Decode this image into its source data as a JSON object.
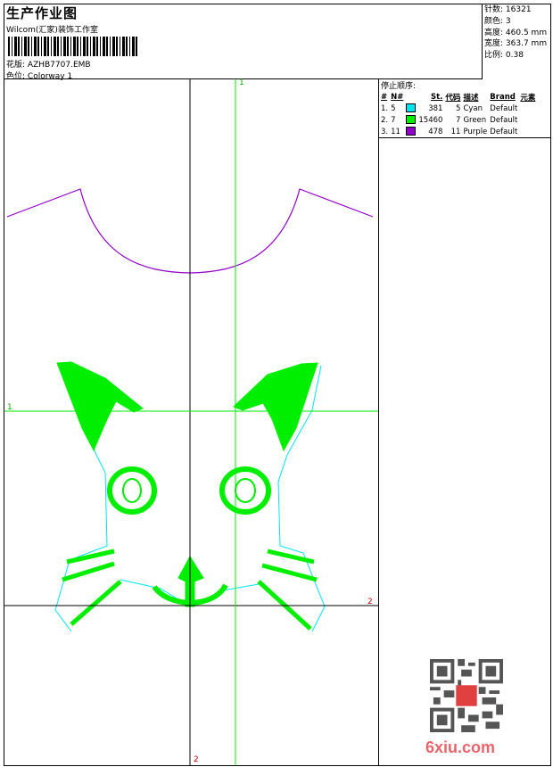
{
  "header": {
    "title": "生产作业图",
    "studio": "Wilcom(汇家)装饰工作室",
    "design_label": "花版:",
    "design_file": "AZHB7707.EMB",
    "colorway_label": "色位:",
    "colorway": "Colorway 1"
  },
  "stats": [
    {
      "label": "针数:",
      "value": "16321"
    },
    {
      "label": "颜色:",
      "value": "3"
    },
    {
      "label": "高度:",
      "value": "460.5 mm"
    },
    {
      "label": "宽度:",
      "value": "363.7 mm"
    },
    {
      "label": "比例:",
      "value": "0.38"
    }
  ],
  "stop_sequence": {
    "title": "停止顺序:",
    "columns": [
      "#",
      "N#",
      "",
      "St.",
      "代码",
      "描述",
      "Brand",
      "元素"
    ],
    "rows": [
      {
        "idx": "1.",
        "n": "5",
        "color": "#00e5f0",
        "st": "381",
        "code": "5",
        "desc": "Cyan",
        "brand": "Default"
      },
      {
        "idx": "2.",
        "n": "7",
        "color": "#00ee00",
        "st": "15460",
        "code": "7",
        "desc": "Green",
        "brand": "Default"
      },
      {
        "idx": "3.",
        "n": "11",
        "color": "#9000c8",
        "st": "478",
        "code": "11",
        "desc": "Purple",
        "brand": "Default"
      }
    ]
  },
  "guides": {
    "green_v": "1",
    "green_h": "1",
    "dark_h": "2",
    "dark_v": "2"
  },
  "watermark": "6xiu.com"
}
